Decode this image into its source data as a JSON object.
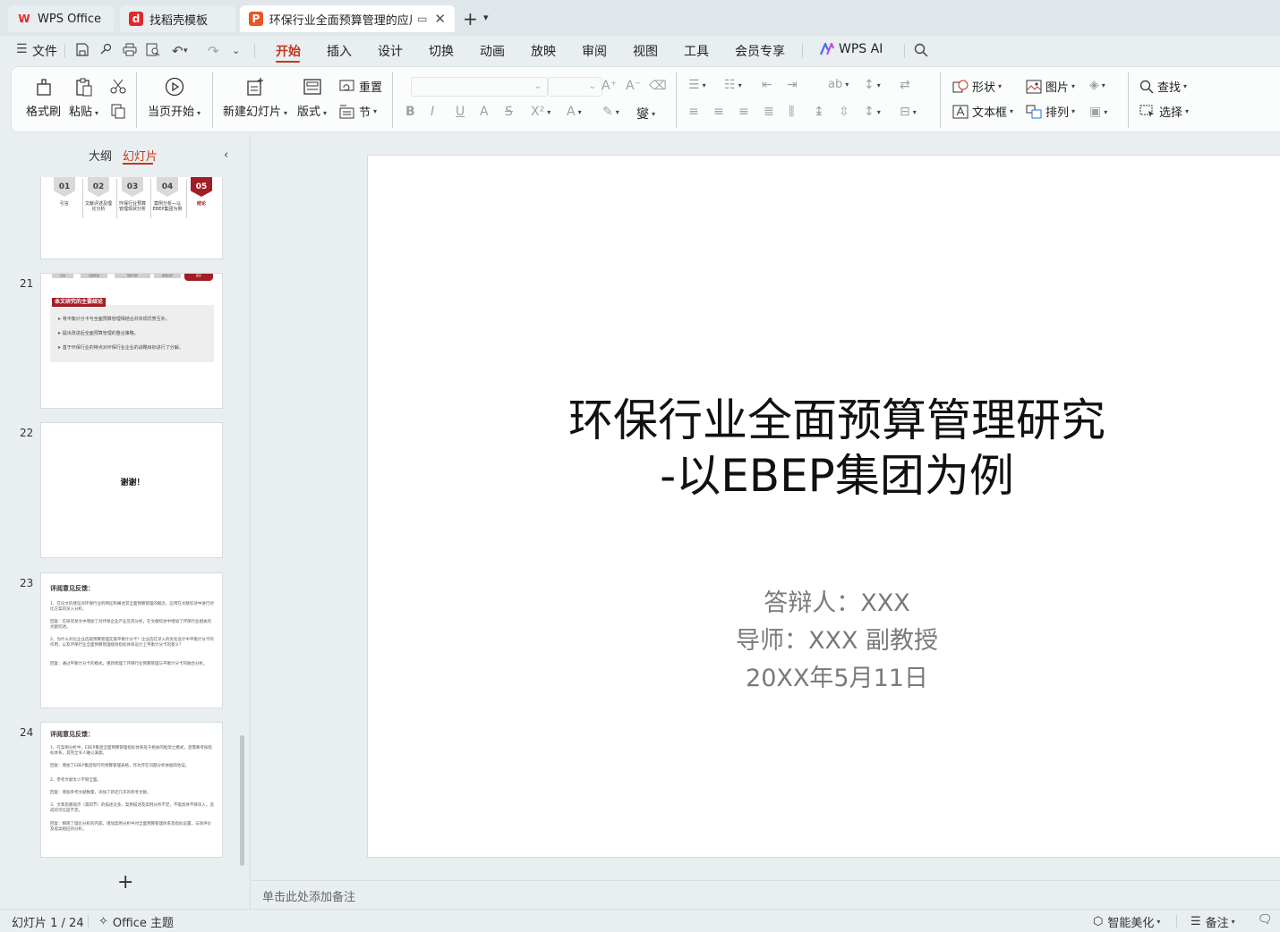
{
  "tabs": [
    {
      "label": "WPS Office",
      "icon": "wps-logo-icon",
      "active": false
    },
    {
      "label": "找稻壳模板",
      "icon": "docer-logo-icon",
      "active": false
    },
    {
      "label": "环保行业全面预算管理的应用",
      "icon": "presentation-logo-icon",
      "active": true
    }
  ],
  "menu": {
    "file": "文件",
    "items": [
      "开始",
      "插入",
      "设计",
      "切换",
      "动画",
      "放映",
      "审阅",
      "视图",
      "工具",
      "会员专享"
    ],
    "active": "开始",
    "ai": "WPS AI"
  },
  "ribbon": {
    "format_painter": "格式刷",
    "paste": "粘贴",
    "from_current": "当页开始",
    "new_slide": "新建幻灯片",
    "layout": "版式",
    "reset": "重置",
    "section": "节",
    "shape": "形状",
    "picture": "图片",
    "textbox": "文本框",
    "arrange": "排列",
    "find": "查找",
    "select": "选择"
  },
  "left_panel": {
    "tab_outline": "大纲",
    "tab_slides": "幻灯片",
    "active_tab": "幻灯片"
  },
  "thumbnails": {
    "t20": {
      "items": [
        {
          "num": "01",
          "label": "引言"
        },
        {
          "num": "02",
          "label": "文献评述及理论分析"
        },
        {
          "num": "03",
          "label": "环保行业预算管理现状分析"
        },
        {
          "num": "04",
          "label": "案例分析—以EBEP集团为例"
        },
        {
          "num": "05",
          "label": "结论"
        }
      ]
    },
    "t21": {
      "number": "21",
      "nav": [
        "引言",
        "文献评述",
        "现状分析",
        "案例分析",
        "结论"
      ],
      "tag": "本文研究的主要结论",
      "bullets": [
        "将平衡计分卡与全面预算管理相结合并实现优势互补。",
        "提出改进后全面预算管理的整合策略。",
        "基于环保行业的特点对环保行业企业的战略目标进行了分解。"
      ]
    },
    "t22": {
      "number": "22",
      "text": "谢谢！"
    },
    "t23": {
      "number": "23",
      "title": "评阅意见反馈：",
      "paras": [
        "1、在论文的建议对环保行业的特征和阐述其全面预算管理的概念、应用在文献综述中进行对比方案的深入分析。",
        "回复：在研究某文中增加了对环保企业产业及其分析，在文献综述中增加了环保行业相关的文献综述。",
        "2、为什么对比企业选取预算管理实施平衡计分卡？企业选在深入的优化设计中平衡计分卡的作用，以及环保行业全面预算管理绩效指标体系设计上平衡计分卡的意义？",
        "回复：通过平衡计分卡的模式，重新梳理了环保行业预算管理与平衡计分卡的融合分析。"
      ]
    },
    "t24": {
      "number": "24",
      "title": "评阅意见反馈：",
      "paras": [
        "1、在案例分析中，EBEP集团全面预算管理指标体系处于相关的框架之模式，且需要考核指标体系，其完全令人难以满意。",
        "回复：增加了EBEP集团现行的预算管理表格，作为存在问题分析依据的佐证。",
        "2、参考文献太少不够全面。",
        "回复：增加参考文献数量，添加了新近几年的参考文献。",
        "3、文章思路观点（第四节）的描述过多，案例描述及案例分析不足，不能具体不够深入，造成的可信度不足。",
        "回复：精简了理论分析的内容，增加案例分析中对全面预算管理体系及指标设置，与效评价及提高相应的分析。"
      ]
    }
  },
  "slide": {
    "title_line1": "环保行业全面预算管理研究",
    "title_line2": "-以EBEP集团为例",
    "presenter": "答辩人：XXX",
    "advisor": "导师：XXX 副教授",
    "date": "20XX年5月11日"
  },
  "notes_placeholder": "单击此处添加备注",
  "status": {
    "slide_counter": "幻灯片 1 / 24",
    "theme": "Office 主题",
    "beautify": "智能美化",
    "notes": "备注"
  },
  "colors": {
    "accent": "#c1381e",
    "slide_red": "#a31d24"
  }
}
